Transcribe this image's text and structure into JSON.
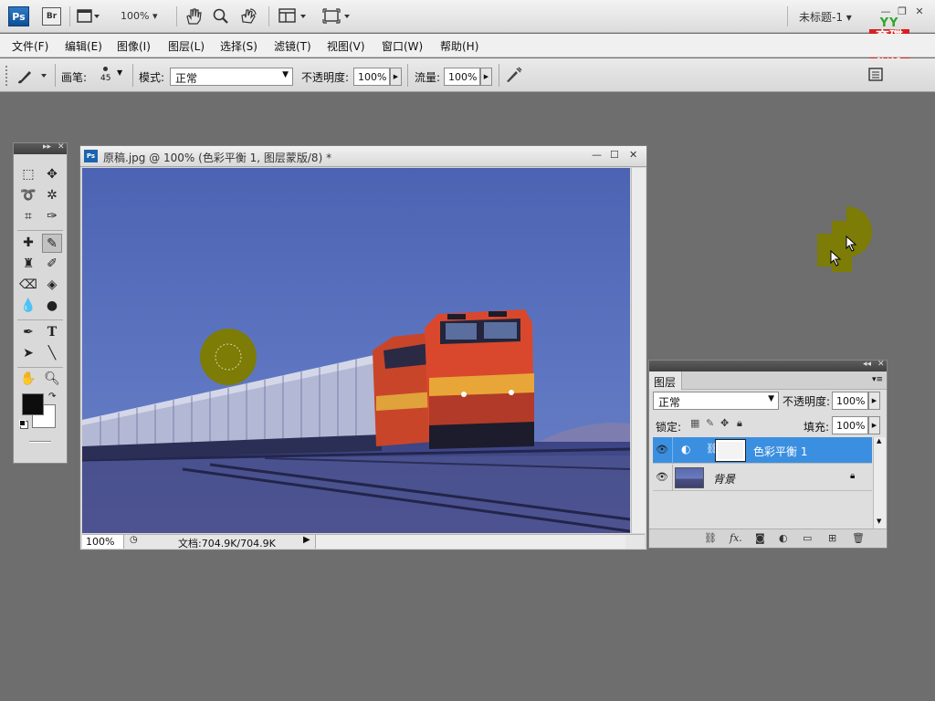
{
  "appbar": {
    "ps_label": "Ps",
    "br_label": "Br",
    "zoom": "100%",
    "doc_title": "未标题-1",
    "brand_top": "YY",
    "brand_box_1": "育碟",
    "brand_box_2": "教育"
  },
  "menu": {
    "items": [
      "文件(F)",
      "编辑(E)",
      "图像(I)",
      "图层(L)",
      "选择(S)",
      "滤镜(T)",
      "视图(V)",
      "窗口(W)",
      "帮助(H)"
    ]
  },
  "options": {
    "brush_label": "画笔:",
    "brush_size": "45",
    "mode_label": "模式:",
    "mode_value": "正常",
    "opacity_label": "不透明度:",
    "opacity_value": "100%",
    "flow_label": "流量:",
    "flow_value": "100%"
  },
  "document": {
    "title": "原稿.jpg @ 100% (色彩平衡 1, 图层蒙版/8) *",
    "zoom": "100%",
    "doc_info": "文档:704.9K/704.9K"
  },
  "layers": {
    "tab_label": "图层",
    "blend_mode": "正常",
    "opacity_label": "不透明度:",
    "opacity_value": "100%",
    "lock_label": "锁定:",
    "fill_label": "填充:",
    "fill_value": "100%",
    "rows": [
      {
        "name": "色彩平衡 1",
        "selected": true
      },
      {
        "name": "背景",
        "selected": false
      }
    ]
  },
  "colors": {
    "foreground": "#0d0d0d",
    "background": "#ffffff",
    "selection": "#3b8fe0",
    "brush_cursor": "#7c7c06"
  }
}
